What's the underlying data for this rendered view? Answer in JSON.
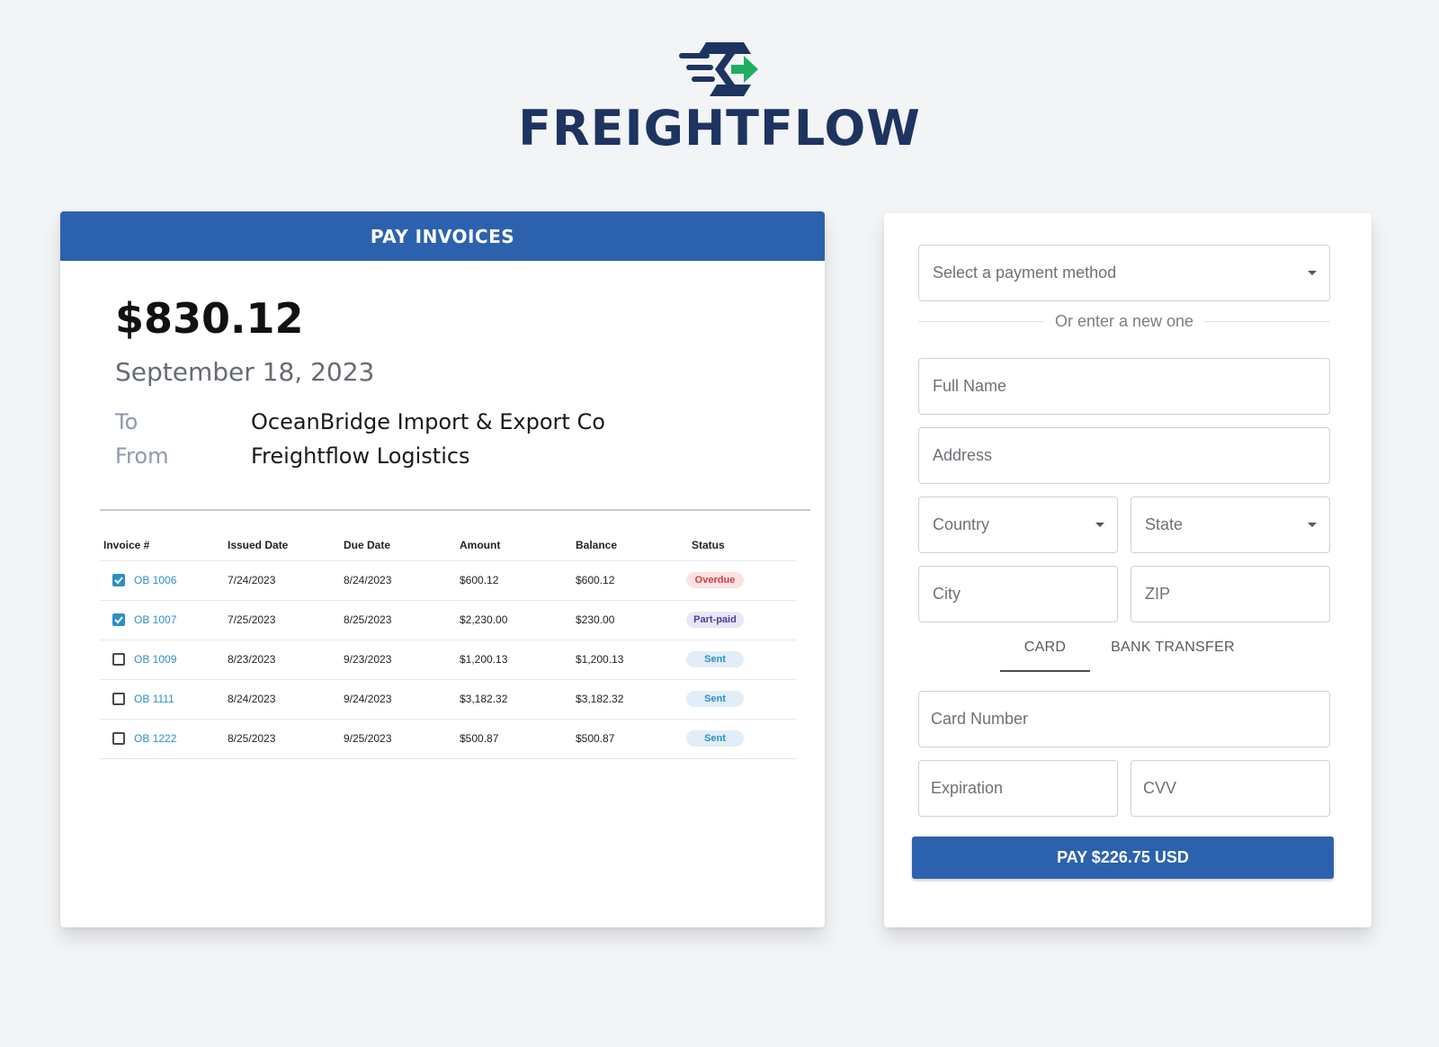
{
  "brand": {
    "name": "FREIGHTFLOW",
    "colors": {
      "primary": "#1e3460",
      "accent": "#1eae63",
      "header": "#2c62ad"
    }
  },
  "invoice_panel": {
    "header": "PAY INVOICES",
    "total": "$830.12",
    "date": "September 18, 2023",
    "to_label": "To",
    "to_value": "OceanBridge Import & Export Co",
    "from_label": "From",
    "from_value": "Freightflow Logistics",
    "columns": [
      "Invoice #",
      "Issued Date",
      "Due Date",
      "Amount",
      "Balance",
      "Status"
    ],
    "rows": [
      {
        "checked": true,
        "invoice": "OB 1006",
        "issued": "7/24/2023",
        "due": "8/24/2023",
        "amount": "$600.12",
        "balance": "$600.12",
        "status": "Overdue"
      },
      {
        "checked": true,
        "invoice": "OB 1007",
        "issued": "7/25/2023",
        "due": "8/25/2023",
        "amount": "$2,230.00",
        "balance": "$230.00",
        "status": "Part-paid"
      },
      {
        "checked": false,
        "invoice": "OB 1009",
        "issued": "8/23/2023",
        "due": "9/23/2023",
        "amount": "$1,200.13",
        "balance": "$1,200.13",
        "status": "Sent"
      },
      {
        "checked": false,
        "invoice": "OB 1111",
        "issued": "8/24/2023",
        "due": "9/24/2023",
        "amount": "$3,182.32",
        "balance": "$3,182.32",
        "status": "Sent"
      },
      {
        "checked": false,
        "invoice": "OB 1222",
        "issued": "8/25/2023",
        "due": "9/25/2023",
        "amount": "$500.87",
        "balance": "$500.87",
        "status": "Sent"
      }
    ]
  },
  "payment_panel": {
    "payment_method_placeholder": "Select a payment method",
    "or_text": "Or enter a new one",
    "full_name": "Full Name",
    "address": "Address",
    "country": "Country",
    "state": "State",
    "city": "City",
    "zip": "ZIP",
    "tabs": [
      "CARD",
      "BANK TRANSFER"
    ],
    "active_tab": "CARD",
    "card_number": "Card Number",
    "expiration": "Expiration",
    "cvv": "CVV",
    "pay_button": "PAY $226.75 USD"
  }
}
